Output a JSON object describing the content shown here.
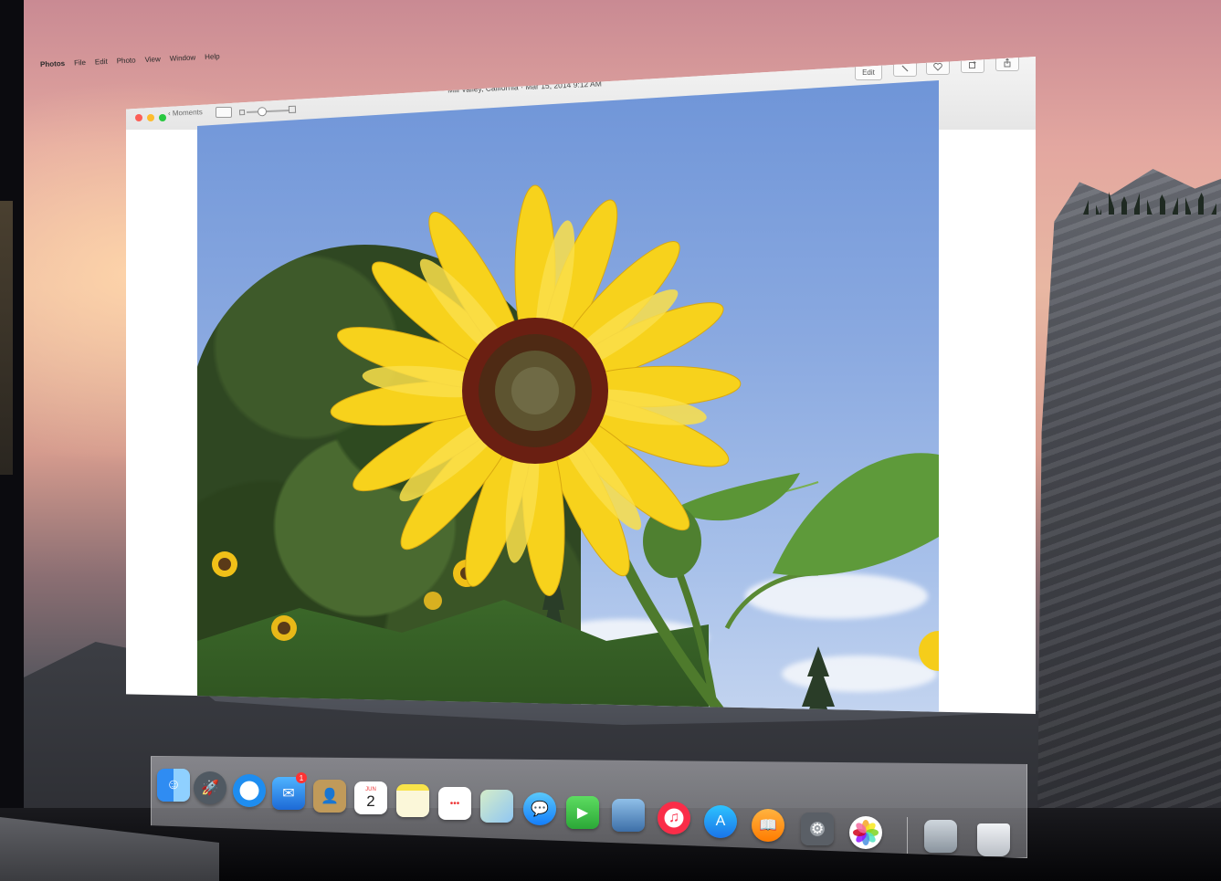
{
  "menubar": {
    "apple": "",
    "items": [
      "Photos",
      "File",
      "Edit",
      "Photo",
      "View",
      "Window",
      "Help"
    ]
  },
  "window": {
    "back_label": "Moments",
    "title": "Mill Valley, California",
    "separator": "·",
    "datetime": "Mar 15, 2014 9:12 AM",
    "toolbar": {
      "edit_label": "Edit",
      "icons": [
        "magic-wand-icon",
        "heart-icon",
        "add-to-icon",
        "share-icon"
      ]
    }
  },
  "photo": {
    "subject": "sunflower"
  },
  "dock": {
    "apps": [
      "finder-icon",
      "launchpad-icon",
      "safari-icon",
      "mail-icon",
      "contacts-icon",
      "calendar-icon",
      "notes-icon",
      "reminders-icon",
      "maps-icon",
      "messages-icon",
      "facetime-icon",
      "iphoto-icon",
      "itunes-icon",
      "app-store-icon",
      "ibooks-icon",
      "system-preferences-icon",
      "photos-icon",
      "preview-icon",
      "trash-icon"
    ],
    "mail_badge": "1",
    "calendar_month": "JUN",
    "calendar_day": "2"
  },
  "colors": {
    "close": "#fc5f57",
    "minimize": "#fdbc2e",
    "maximize": "#28c840",
    "sky": "#6f95d8",
    "petal": "#f7d21c"
  }
}
